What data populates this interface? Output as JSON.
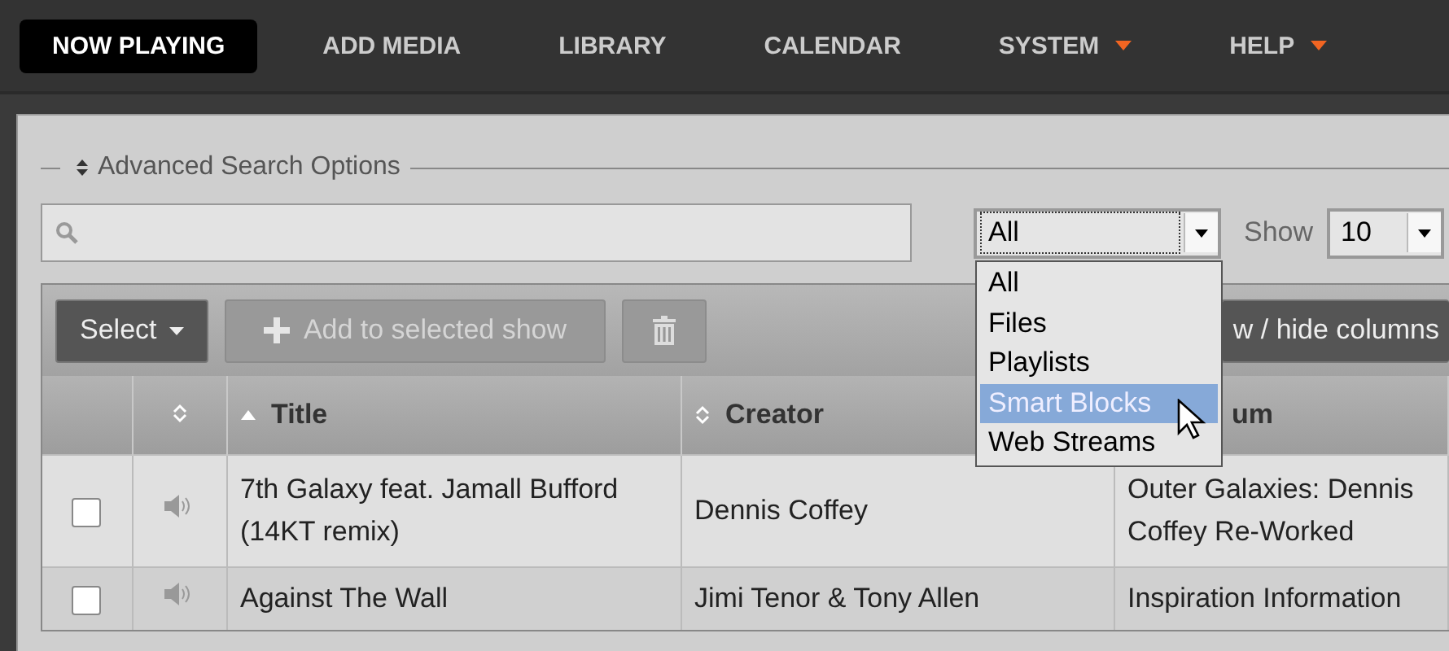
{
  "nav": [
    {
      "label": "NOW PLAYING",
      "selected": true,
      "has_menu": false
    },
    {
      "label": "ADD MEDIA",
      "selected": false,
      "has_menu": false
    },
    {
      "label": "LIBRARY",
      "selected": false,
      "has_menu": false
    },
    {
      "label": "CALENDAR",
      "selected": false,
      "has_menu": false
    },
    {
      "label": "SYSTEM",
      "selected": false,
      "has_menu": true
    },
    {
      "label": "HELP",
      "selected": false,
      "has_menu": true
    }
  ],
  "search": {
    "legend": "Advanced Search Options"
  },
  "type_filter": {
    "value": "All",
    "open": true,
    "options": [
      {
        "label": "All",
        "highlighted": false
      },
      {
        "label": "Files",
        "highlighted": false
      },
      {
        "label": "Playlists",
        "highlighted": false
      },
      {
        "label": "Smart Blocks",
        "highlighted": true
      },
      {
        "label": "Web Streams",
        "highlighted": false
      }
    ]
  },
  "show": {
    "label": "Show",
    "value": "10"
  },
  "toolbar": {
    "select_button": "Select",
    "add_button": {
      "label": "Add to selected show",
      "disabled": true
    },
    "delete_button": {
      "disabled": true
    },
    "columns_button": "w / hide columns"
  },
  "table": {
    "columns": [
      {
        "label": "Title",
        "sorted_ascending": true
      },
      {
        "label": "Creator",
        "sorted_ascending": false
      },
      {
        "label": "um"
      }
    ],
    "rows": [
      {
        "checked": false,
        "title": "7th Galaxy feat. Jamall Bufford (14KT remix)",
        "creator": "Dennis Coffey",
        "column_3": "Outer Galaxies: Dennis Coffey Re-Worked"
      },
      {
        "checked": false,
        "title": "Against The Wall",
        "creator": "Jimi Tenor & Tony Allen",
        "column_3": "Inspiration Information"
      }
    ]
  }
}
